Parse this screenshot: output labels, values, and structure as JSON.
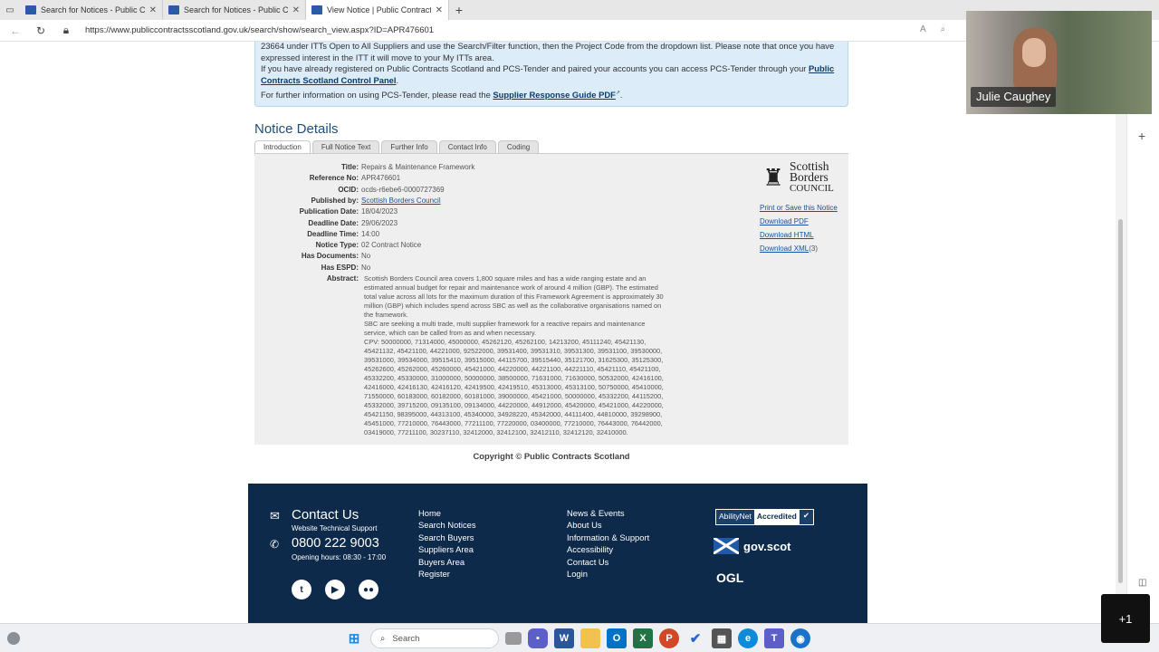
{
  "browser": {
    "tabs": [
      {
        "title": "Search for Notices - Public Contracts Scotland",
        "active": false
      },
      {
        "title": "Search for Notices - Public Contracts Scotland",
        "active": false
      },
      {
        "title": "View Notice | Public Contracts Scotland",
        "active": true
      }
    ],
    "url": "https://www.publiccontractsscotland.gov.uk/search/show/search_view.aspx?ID=APR476601"
  },
  "infobox": {
    "line1": "23664 under ITTs Open to All Suppliers and use the Search/Filter function, then the Project Code from the dropdown list. Please note that once you have expressed interest in the ITT it will move to your My ITTs area.",
    "line2_prefix": "If you have already registered on Public Contracts Scotland and PCS-Tender and paired your accounts you can access PCS-Tender through your ",
    "line2_link": "Public Contracts Scotland Control Panel",
    "line2_suffix": ".",
    "line3_prefix": "For further information on using PCS-Tender, please read the ",
    "line3_link": "Supplier Response Guide PDF",
    "line3_suffix": "."
  },
  "notice": {
    "section_title": "Notice Details",
    "tabs": [
      "Introduction",
      "Full Notice Text",
      "Further Info",
      "Contact Info",
      "Coding"
    ],
    "fields": [
      {
        "label": "Title:",
        "value": "Repairs & Maintenance Framework",
        "link": false
      },
      {
        "label": "Reference No:",
        "value": "APR476601",
        "link": false
      },
      {
        "label": "OCID:",
        "value": "ocds-r6ebe6-0000727369",
        "link": false
      },
      {
        "label": "Published by:",
        "value": "Scottish Borders Council",
        "link": true
      },
      {
        "label": "Publication Date:",
        "value": "18/04/2023",
        "link": false
      },
      {
        "label": "Deadline Date:",
        "value": "29/06/2023",
        "link": false
      },
      {
        "label": "Deadline Time:",
        "value": "14:00",
        "link": false
      },
      {
        "label": "Notice Type:",
        "value": "02 Contract Notice",
        "link": false
      },
      {
        "label": "Has Documents:",
        "value": "No",
        "link": false
      },
      {
        "label": "Has ESPD:",
        "value": "No",
        "link": false
      }
    ],
    "abstract_label": "Abstract:",
    "abstract_p1": "Scottish Borders Council area covers 1,800 square miles and has a wide ranging estate and an estimated annual budget for repair and maintenance work of around 4 million (GBP). The estimated total value across all lots for the maximum duration of this Framework Agreement is approximately 30 million (GBP) which includes spend across SBC as well as the collaborative organisations named on the framework.",
    "abstract_p2": "SBC are seeking a multi trade, multi supplier framework for a reactive repairs and maintenance service, which can be called from as and when necessary.",
    "abstract_cpv": "CPV: 50000000, 71314000, 45000000, 45262120, 45262100, 14213200, 45111240, 45421130, 45421132, 45421100, 44221000, 92522000, 39531400, 39531310, 39531300, 39531100, 39530000, 39531000, 39534000, 39515410, 39515000, 44115700, 39515440, 35121700, 31625300, 35125300, 45262600, 45262000, 45260000, 45421000, 44220000, 44221100, 44221110, 45421110, 45421100, 45332200, 45330000, 31000000, 50000000, 38500000, 71631000, 71630000, 50532000, 42416100, 42416000, 42416130, 42416120, 42419500, 42419510, 45313000, 45313100, 50750000, 45410000, 71550000, 60183000, 60182000, 60181000, 39000000, 45421000, 50000000, 45332200, 44115200, 45332000, 39715200, 09135100, 09134000, 44220000, 44912000, 45420000, 45421000, 44220000, 45421150, 98395000, 44313100, 45340000, 34928220, 45342000, 44111400, 44810000, 39298900, 45451000, 77210000, 76443000, 77211100, 77220000, 03400000, 77210000, 76443000, 76442000, 03419000, 77211100, 30237110, 32412000, 32412100, 32412110, 32412120, 32410000.",
    "logo_line1": "Scottish",
    "logo_line2": "Borders",
    "logo_line3": "COUNCIL",
    "side_links": [
      "Print or Save this Notice",
      "Download PDF",
      "Download HTML",
      "Download XML"
    ],
    "xml_count": "(3)"
  },
  "copyright": "Copyright © Public Contracts Scotland",
  "footer": {
    "contact_title": "Contact Us",
    "support": "Website Technical Support",
    "phone": "0800 222 9003",
    "hours": "Opening hours: 08:30 - 17:00",
    "col1": [
      "Home",
      "Search Notices",
      "Search Buyers",
      "Suppliers Area",
      "Buyers Area",
      "Register"
    ],
    "col2": [
      "News & Events",
      "About Us",
      "Information & Support",
      "Accessibility",
      "Contact Us",
      "Login"
    ],
    "ability_1": "AbilityNet",
    "ability_2": "Accredited",
    "govscot": "gov.scot",
    "ogl": "OGL"
  },
  "video": {
    "name": "Julie Caughey"
  },
  "taskbar": {
    "search": "Search"
  },
  "overlay": {
    "plusone": "+1"
  },
  "colors": {
    "footer_bg": "#0d2a4a",
    "info_bg": "#dcecf9",
    "link": "#1f4e9a",
    "title": "#1f4e79"
  }
}
